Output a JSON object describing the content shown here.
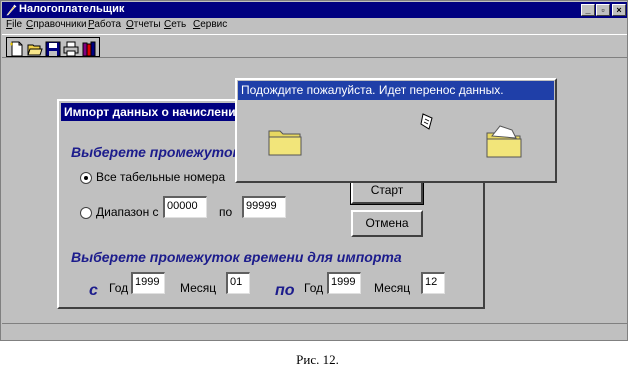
{
  "app": {
    "title": "Налогоплательщик",
    "window_buttons": [
      "_",
      "▫",
      "×"
    ]
  },
  "menu": [
    "File",
    "Справочники",
    "Работа",
    "Отчеты",
    "Сеть",
    "Сервис"
  ],
  "toolbar": {
    "icons": [
      "new-document-icon",
      "open-folder-icon",
      "save-disk-icon",
      "print-icon",
      "books-icon"
    ]
  },
  "import_dialog": {
    "title": "Импорт данных о начислениях",
    "range_heading": "Выберете промежуток",
    "all_numbers_label": "Все табельные номера",
    "all_numbers_selected": true,
    "range_label": "Диапазон с",
    "range_from": "00000",
    "range_to_label": "по",
    "range_to": "99999",
    "start_button": "Старт",
    "cancel_button": "Отмена",
    "time_heading": "Выберете промежуток времени для импорта",
    "from_prefix": "с",
    "from_year_label": "Год",
    "from_year": "1999",
    "from_month_label": "Месяц",
    "from_month": "01",
    "to_prefix": "по",
    "to_year_label": "Год",
    "to_year": "1999",
    "to_month_label": "Месяц",
    "to_month": "12"
  },
  "wait_dialog": {
    "message": "Подождите пожалуйста. Идет перенос данных."
  },
  "caption": "Рис. 12.",
  "colors": {
    "titlebar": "#000080",
    "wait_titlebar": "#1f3fa8",
    "window_face": "#c0c0c0",
    "heading_text": "#1c1c8c",
    "folder": "#f2e57a"
  }
}
